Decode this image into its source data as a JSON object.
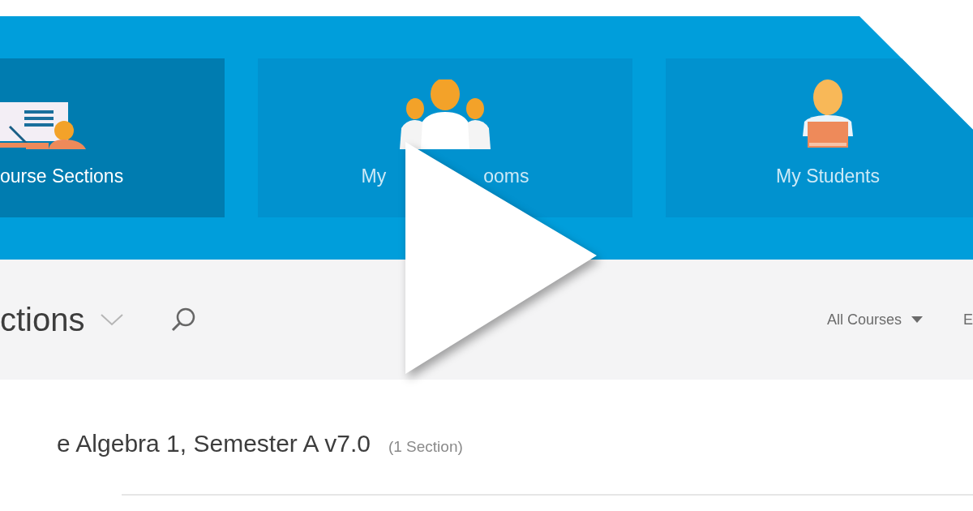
{
  "tiles": [
    {
      "kind": "teacher",
      "label_parts": [
        "ourse Sections"
      ],
      "selected": true
    },
    {
      "kind": "group",
      "label_parts": [
        "My",
        "ooms"
      ],
      "selected": false
    },
    {
      "kind": "student",
      "label_parts": [
        "My Students"
      ],
      "selected": false
    }
  ],
  "toolbar": {
    "title": "ctions",
    "filter": "All Courses",
    "next": "E"
  },
  "course": {
    "name": "e Algebra 1, Semester A v7.0",
    "count": "(1 Section)"
  }
}
